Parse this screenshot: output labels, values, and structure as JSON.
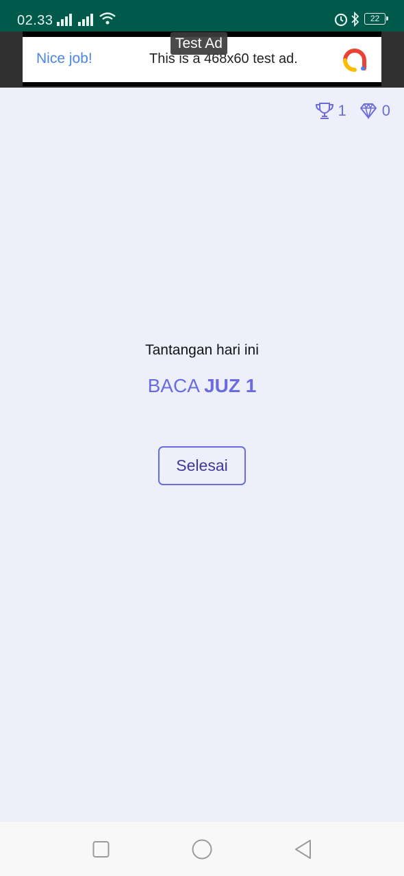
{
  "status_bar": {
    "time": "02.33",
    "battery": "22",
    "icons": [
      "signal-icon",
      "signal-icon",
      "wifi-icon",
      "alarm-icon",
      "bluetooth-icon",
      "battery-icon"
    ]
  },
  "ad": {
    "badge": "Test Ad",
    "headline": "Nice job!",
    "body": "This is a 468x60 test ad.",
    "logo": "admob-logo"
  },
  "counters": {
    "trophy_icon": "trophy-icon",
    "trophies": "1",
    "diamond_icon": "diamond-icon",
    "diamonds": "0"
  },
  "challenge": {
    "title": "Tantangan hari ini",
    "task_prefix": "BACA",
    "task_bold": "JUZ 1"
  },
  "actions": {
    "done_label": "Selesai"
  },
  "nav": {
    "items": [
      "recent-apps-icon",
      "home-icon",
      "back-icon"
    ]
  },
  "colors": {
    "status_bar": "#005a4c",
    "background": "#edf0fb",
    "accent": "#6a6be0",
    "ad_link": "#4a86e0"
  }
}
